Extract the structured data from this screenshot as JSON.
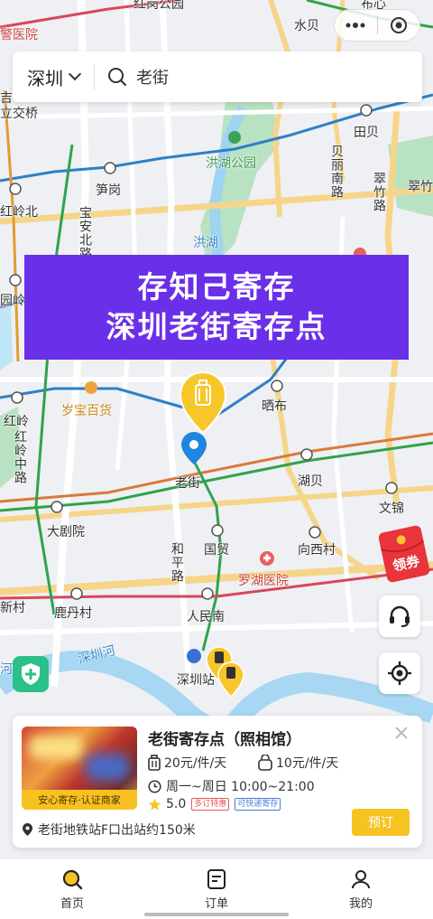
{
  "search": {
    "city": "深圳",
    "keyword": "老街"
  },
  "banner": {
    "line1": "存知己寄存",
    "line2": "深圳老街寄存点"
  },
  "map": {
    "labels": {
      "hospital_tl": "警医院",
      "hongling_top": "红岗公园",
      "shuibei": "水贝",
      "buxin": "布心",
      "bu": "吉",
      "lijiao": "立交桥",
      "tianbei": "田贝",
      "honghu_park": "洪湖公园",
      "sungang": "笋岗",
      "beili_road": "贝丽南路",
      "cuizhu_road": "翠竹路",
      "cui": "翠竹",
      "hongling_north": "红岭北",
      "baoan_north": "宝安北路",
      "honghu_lake": "洪湖",
      "yuanling": "园岭",
      "suibao": "岁宝百货",
      "shibu": "晒布",
      "hongling": "红岭",
      "hongling_road": "红岭中路",
      "laojie": "老街",
      "hubei": "湖贝",
      "wenjin": "文锦",
      "dajuyuan": "大剧院",
      "guomao": "国贸",
      "xiangxicun": "向西村",
      "heping_road": "和平路",
      "luohu_hospital": "罗湖医院",
      "xincun": "新村",
      "ludancun": "鹿丹村",
      "renminnan": "人民南",
      "shenzhen_river": "深圳河",
      "he": "河",
      "shenzhen_station": "深圳站"
    },
    "red_packet_label": "领券"
  },
  "card": {
    "thumb_tag": "安心寄存·认证商家",
    "title": "老街寄存点（照相馆）",
    "price_bag": "20元/件/天",
    "price_small": "10元/件/天",
    "hours": "周一~周日 10:00~21:00",
    "rating": "5.0",
    "badge_discount": "多订特惠",
    "badge_fast": "可快递寄存",
    "location": "老街地铁站F口出站约150米",
    "book_label": "预订"
  },
  "tabs": [
    {
      "label": "首页"
    },
    {
      "label": "订单"
    },
    {
      "label": "我的"
    }
  ],
  "colors": {
    "accent": "#f5c322",
    "banner": "#6a2fe9",
    "metro_green": "#3aa35a"
  }
}
